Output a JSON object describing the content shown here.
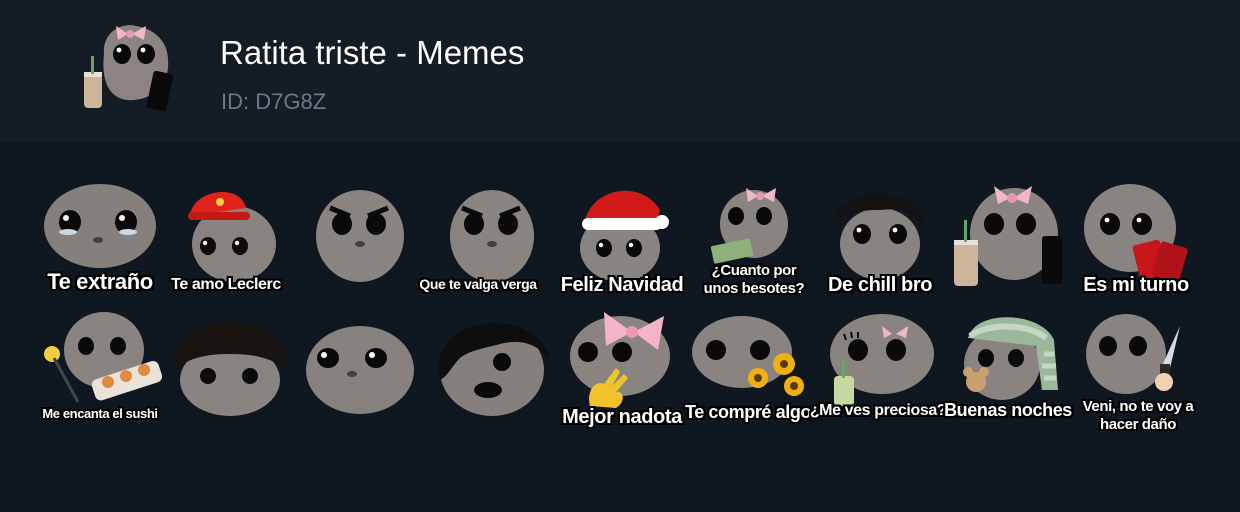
{
  "pack": {
    "title": "Ratita triste - Memes",
    "id_label": "ID: D7G8Z",
    "icon": "hamster-bow-boba-phone-sticker"
  },
  "colors": {
    "background": "#0f1720",
    "header_background": "#141c26",
    "title": "#ffffff",
    "id_text": "#6f7882",
    "caption_fill": "#ffffff",
    "caption_outline": "#000000"
  },
  "stickers": [
    {
      "caption": "Te extraño",
      "icon": "hamster-teary-sticker"
    },
    {
      "caption": "Te amo Leclerc",
      "icon": "hamster-red-cap-sticker"
    },
    {
      "caption": "Que te valga verga",
      "icon": "hamster-angry-sticker"
    },
    {
      "caption": "Feliz Navidad",
      "icon": "hamster-santa-hat-sticker"
    },
    {
      "caption": "¿Cuanto por\nunos besotes?",
      "icon": "hamster-money-bow-sticker"
    },
    {
      "caption": "De chill bro",
      "icon": "hamster-black-hair-sticker"
    },
    {
      "caption": "Es mi turno",
      "icon": "hamster-uno-cards-sticker"
    },
    {
      "caption": "Me encanta el sushi",
      "icon": "hamster-sushi-sticker"
    },
    {
      "caption": "",
      "icon": "hamster-bowl-cut-sticker"
    },
    {
      "caption": "",
      "icon": "hamster-sad-eyes-sticker"
    },
    {
      "caption": "",
      "icon": "hamster-emo-hair-lips-sticker"
    },
    {
      "caption": "Mejor nadota",
      "icon": "hamster-pink-bow-wave-sticker"
    },
    {
      "caption": "Te compré algo",
      "icon": "hamster-sunflowers-sticker"
    },
    {
      "caption": "¿Me ves preciosa?",
      "icon": "hamster-lashes-matcha-sticker"
    },
    {
      "caption": "Buenas noches",
      "icon": "hamster-sleep-cap-teddy-sticker"
    },
    {
      "caption": "Veni, no te voy a\nhacer daño",
      "icon": "hamster-knife-sticker"
    },
    {
      "caption": "",
      "icon": "hamster-bow-boba-phone-sticker"
    },
    {
      "caption": "",
      "icon": "hamster-angry-sticker"
    }
  ]
}
